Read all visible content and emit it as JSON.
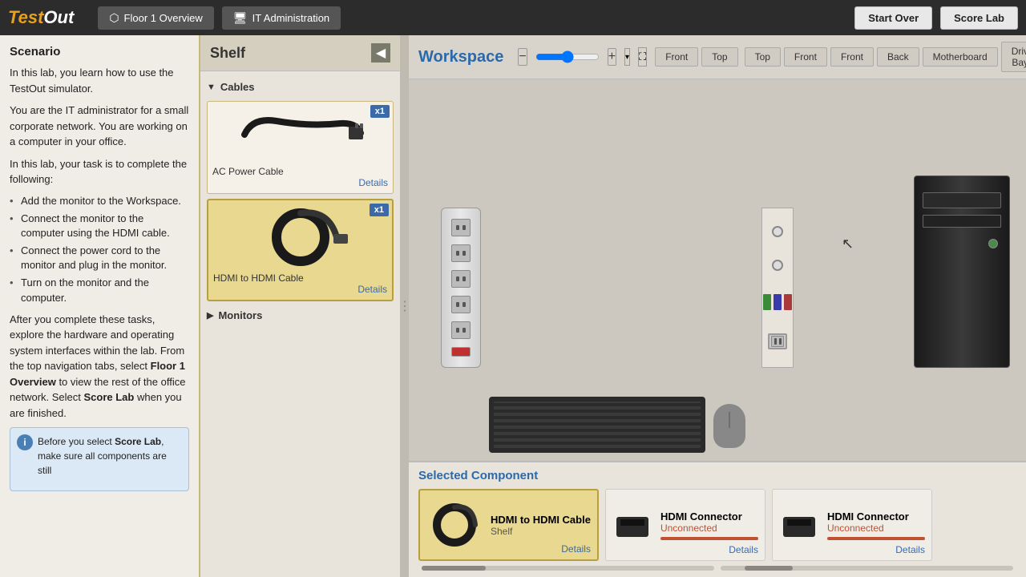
{
  "app": {
    "logo": "TestOut",
    "nav": {
      "floor_overview_label": "Floor 1 Overview",
      "it_admin_label": "IT Administration",
      "start_over_label": "Start Over",
      "score_lab_label": "Score Lab"
    }
  },
  "scenario": {
    "title": "Scenario",
    "paragraphs": [
      "In this lab, you learn how to use the TestOut simulator.",
      "You are the IT administrator for a small corporate network. You are working on a computer in your office.",
      "In this lab, your task is to complete the following:"
    ],
    "tasks": [
      "Add the monitor to the Workspace.",
      "Connect the monitor to the computer using the HDMI cable.",
      "Connect the power cord to the monitor and plug in the monitor.",
      "Turn on the monitor and the computer."
    ],
    "after_text": "After you complete these tasks, explore the hardware and operating system interfaces within the lab. From the top navigation tabs, select Floor 1 Overview to view the rest of the office network. Select Score Lab when you are finished.",
    "info_box": "Before you select Score Lab, make sure all components are still"
  },
  "shelf": {
    "title": "Shelf",
    "categories": [
      {
        "name": "Cables",
        "expanded": true,
        "items": [
          {
            "id": "ac-power-cable",
            "label": "AC Power Cable",
            "badge": "x1",
            "selected": false
          },
          {
            "id": "hdmi-cable",
            "label": "HDMI to HDMI Cable",
            "badge": "x1",
            "selected": true
          }
        ]
      },
      {
        "name": "Monitors",
        "expanded": false,
        "items": []
      }
    ]
  },
  "workspace": {
    "title": "Workspace",
    "tabs_left": [
      "Front",
      "Top"
    ],
    "tabs_right": [
      "Top",
      "Front",
      "Front",
      "Back",
      "Motherboard",
      "Drive Bays"
    ]
  },
  "selected_component": {
    "title": "Selected Component",
    "cards": [
      {
        "id": "hdmi-cable-card",
        "name": "HDMI to HDMI Cable",
        "location": "Shelf",
        "selected": true,
        "details_label": "Details"
      },
      {
        "id": "hdmi-connector-1",
        "name": "HDMI Connector",
        "status": "Unconnected",
        "details_label": "Details"
      },
      {
        "id": "hdmi-connector-2",
        "name": "HDMI Connector",
        "status": "Unconnected",
        "details_label": "Details"
      }
    ]
  }
}
